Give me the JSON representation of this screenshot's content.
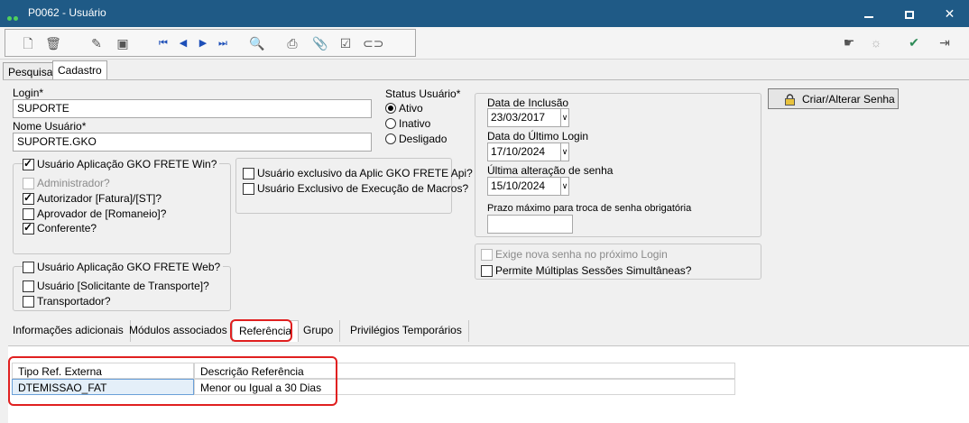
{
  "window": {
    "title": "P0062 - Usuário"
  },
  "toolbar": {
    "icons": [
      "new-icon",
      "delete-icon",
      "edit-icon",
      "save-icon",
      "first-icon",
      "prev-icon",
      "next-icon",
      "last-icon",
      "search-icon",
      "print-icon",
      "attach-icon",
      "check-icon",
      "link-icon",
      "pointer-icon",
      "bulb-icon",
      "confirm-icon",
      "exit-icon"
    ]
  },
  "tabs_top": [
    "Pesquisa",
    "Cadastro"
  ],
  "form": {
    "login_label": "Login*",
    "login_value": "SUPORTE",
    "nome_label": "Nome Usuário*",
    "nome_value": "SUPORTE.GKO",
    "status_label": "Status Usuário*",
    "status_options": [
      "Ativo",
      "Inativo",
      "Desligado"
    ],
    "status_selected": "Ativo",
    "win_group": {
      "title": "Usuário Aplicação GKO FRETE Win?",
      "items": [
        "Administrador?",
        "Autorizador [Fatura]/[ST]?",
        "Aprovador de [Romaneio]?",
        "Conferente?"
      ]
    },
    "api_items": [
      "Usuário exclusivo da Aplic GKO FRETE Api?",
      "Usuário Exclusivo de Execução de Macros?"
    ],
    "web_group": {
      "title": "Usuário Aplicação GKO FRETE Web?",
      "items": [
        "Usuário [Solicitante de Transporte]?",
        "Transportador?"
      ]
    },
    "data_inclusao_label": "Data de Inclusão",
    "data_inclusao_value": "23/03/2017",
    "data_login_label": "Data do Último Login",
    "data_login_value": "17/10/2024",
    "ultima_senha_label": "Última alteração de senha",
    "ultima_senha_value": "15/10/2024",
    "prazo_label": "Prazo máximo para troca de senha obrigatória",
    "prazo_value": "",
    "exige_label": "Exige nova senha no próximo Login",
    "multiplas_label": "Permite Múltiplas Sessões Simultâneas?",
    "pw_button": "Criar/Alterar Senha"
  },
  "tabs_bottom": [
    "Informações adicionais",
    "Módulos associados",
    "Referência",
    "Grupo",
    "Privilégios Temporários"
  ],
  "grid": {
    "columns": [
      "Tipo Ref. Externa",
      "Descrição Referência"
    ],
    "rows": [
      [
        "DTEMISSAO_FAT",
        "Menor ou Igual a 30 Dias"
      ]
    ]
  },
  "colors": {
    "titlebar": "#1f5a86",
    "highlight": "#e02020"
  }
}
